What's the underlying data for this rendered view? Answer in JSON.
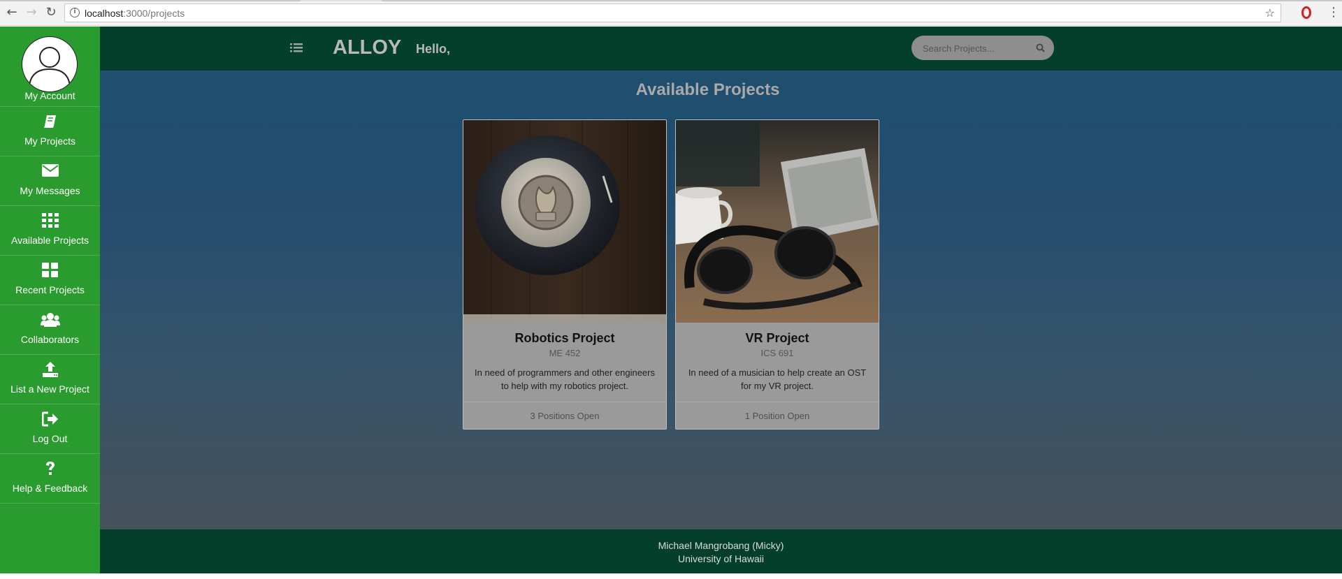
{
  "browser": {
    "url_host": "localhost",
    "url_path": ":3000/projects",
    "icons": [
      "back-arrow-icon",
      "forward-arrow-icon",
      "reload-icon",
      "info-icon",
      "star-icon",
      "opera-icon",
      "kebab-menu-icon"
    ]
  },
  "sidebar": {
    "account_label": "My Account",
    "items": [
      {
        "label": "My Projects",
        "icon": "book-icon"
      },
      {
        "label": "My Messages",
        "icon": "envelope-icon"
      },
      {
        "label": "Available Projects",
        "icon": "grid-icon"
      },
      {
        "label": "Recent Projects",
        "icon": "tiles-icon"
      },
      {
        "label": "Collaborators",
        "icon": "users-icon"
      },
      {
        "label": "List a New Project",
        "icon": "upload-icon"
      },
      {
        "label": "Log Out",
        "icon": "sign-out-icon"
      },
      {
        "label": "Help & Feedback",
        "icon": "question-icon"
      }
    ]
  },
  "header": {
    "brand": "ALLOY",
    "greeting": "Hello,",
    "search_placeholder": "Search Projects..."
  },
  "main": {
    "title": "Available Projects",
    "cards": [
      {
        "title": "Robotics Project",
        "code": "ME 452",
        "description": "In need of programmers and other engineers to help with my robotics project.",
        "positions": "3 Positions Open",
        "image": "tape-measure"
      },
      {
        "title": "VR Project",
        "code": "ICS 691",
        "description": "In need of a musician to help create an OST for my VR project.",
        "positions": "1 Position Open",
        "image": "headphones"
      }
    ]
  },
  "footer": {
    "name": "Michael Mangrobang (Micky)",
    "school": "University of Hawaii"
  },
  "colors": {
    "sidebar": "#2a9b2f",
    "topbar": "#033f2b",
    "card": "#9a9a9a"
  }
}
